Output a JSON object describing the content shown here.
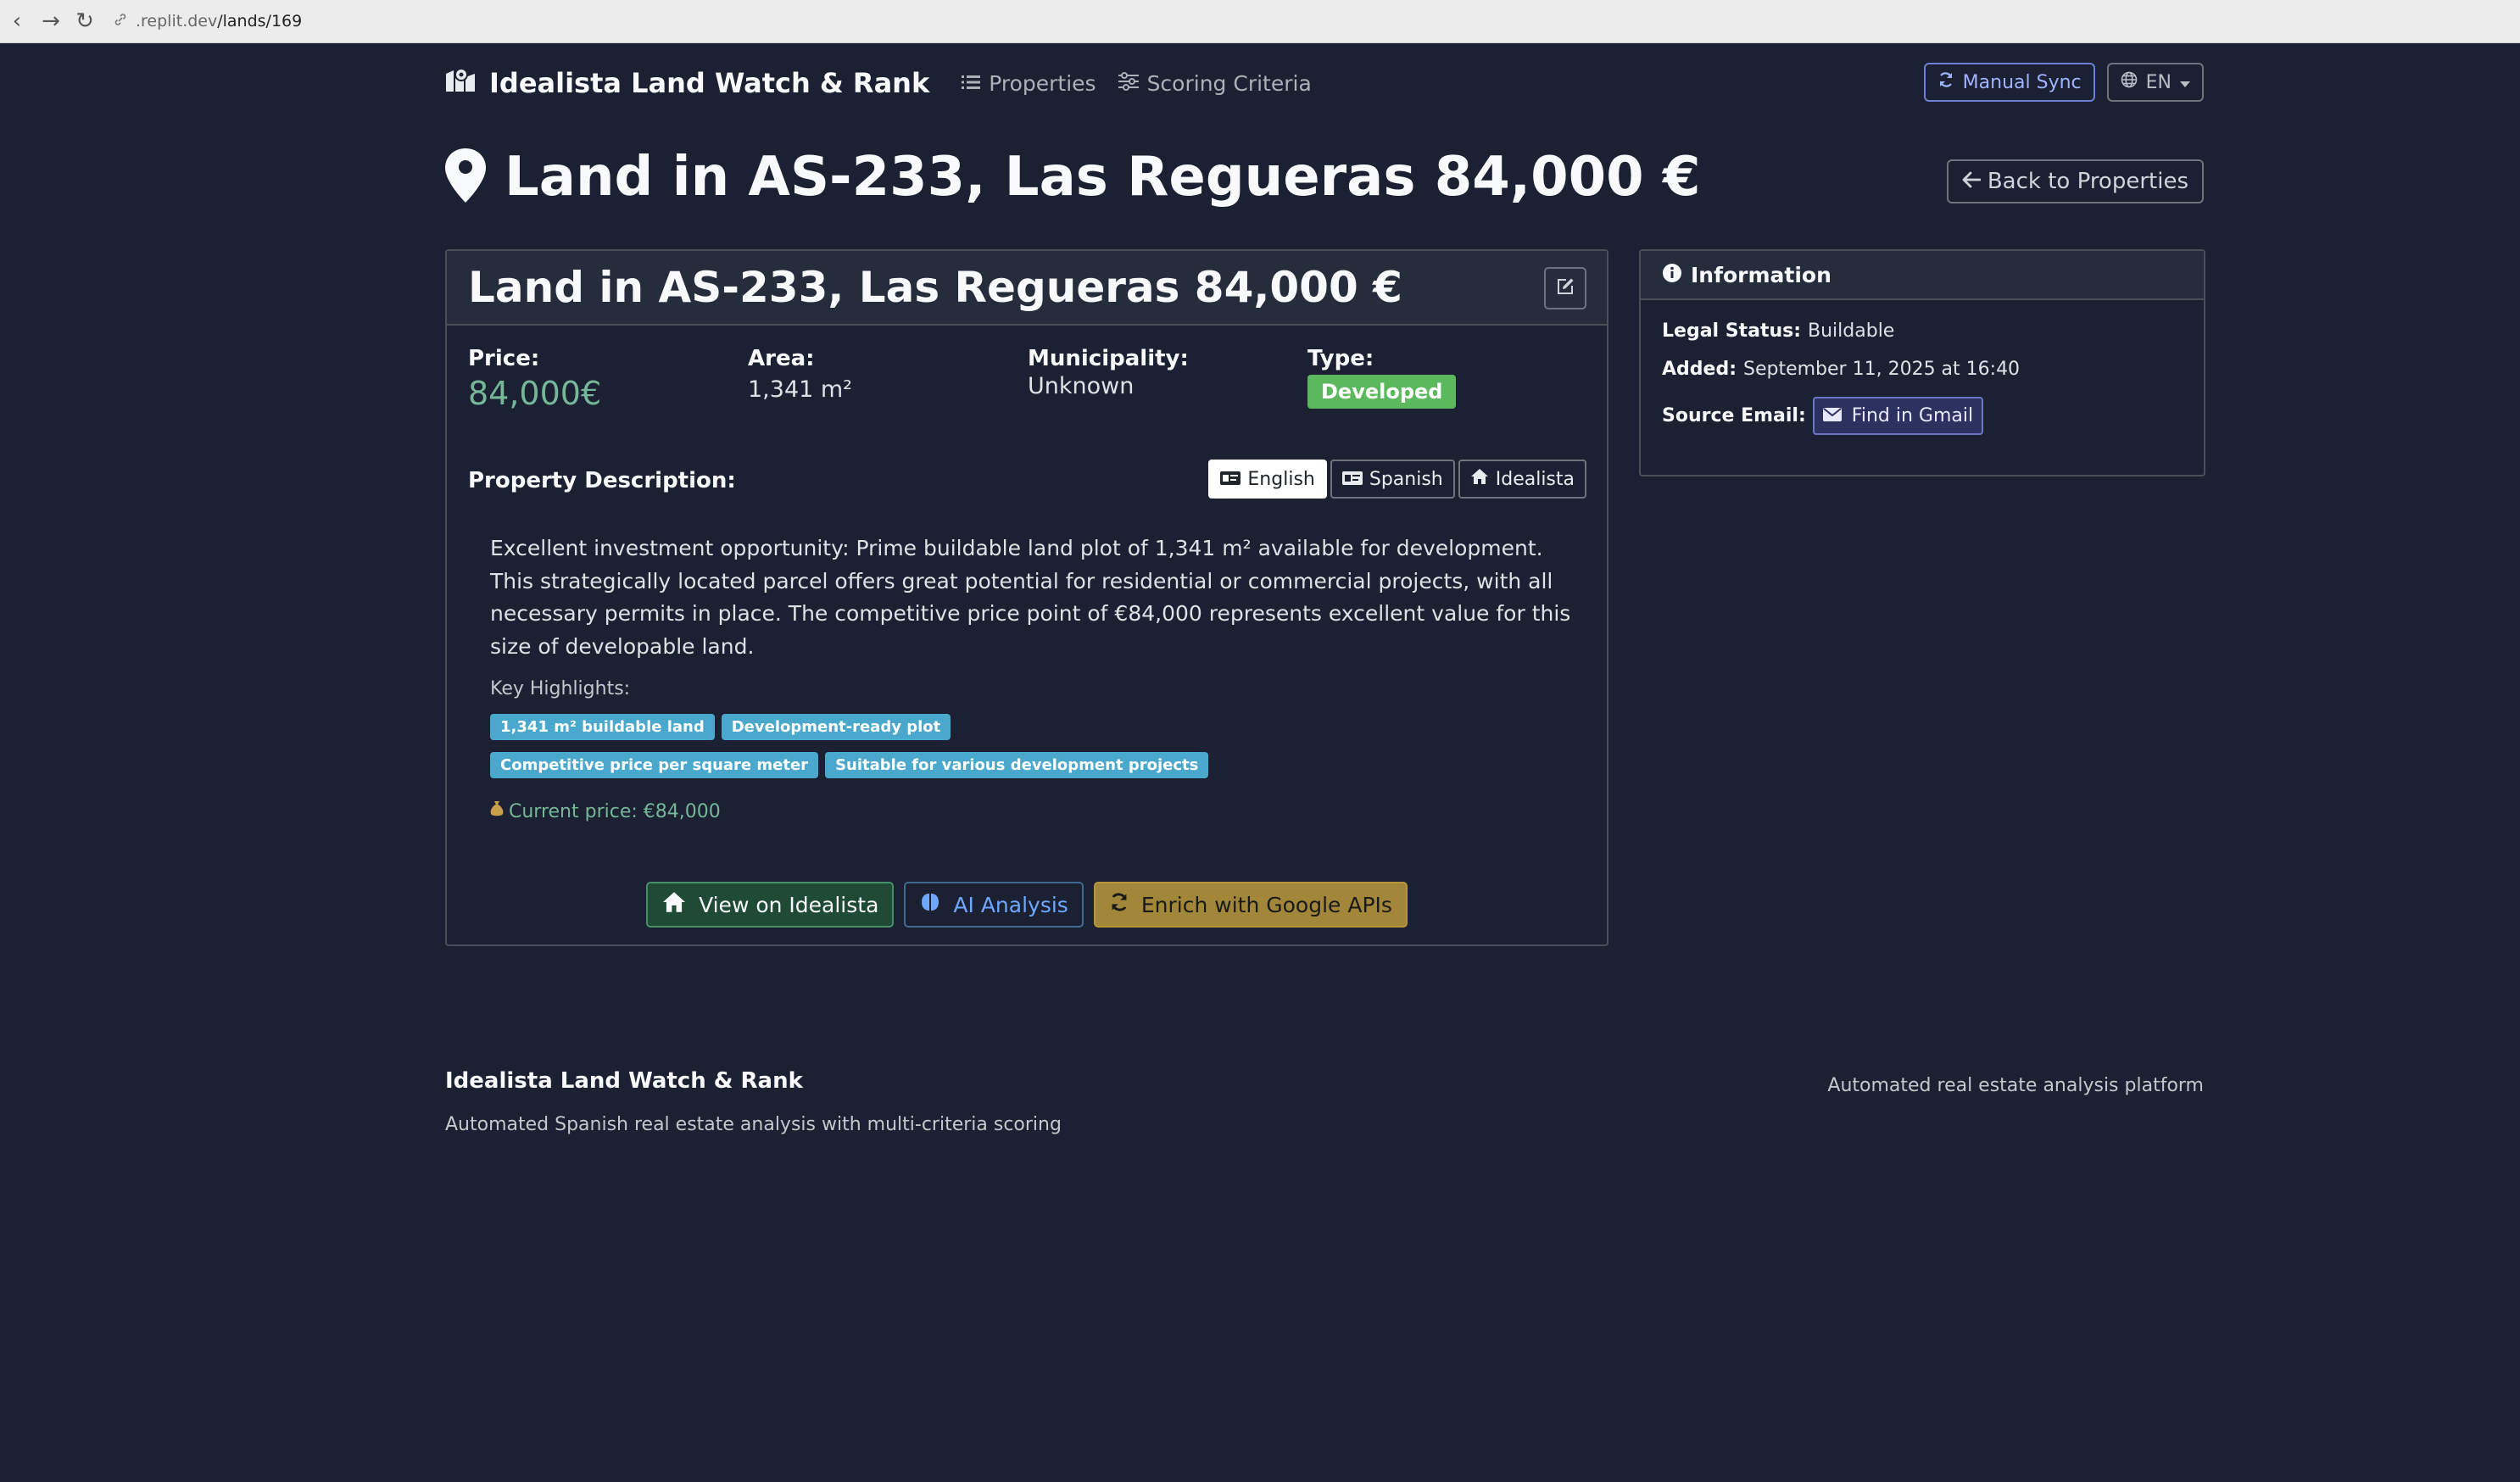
{
  "browser": {
    "url_domain": ".replit.dev",
    "url_path": "/lands/169"
  },
  "navbar": {
    "brand": "Idealista Land Watch & Rank",
    "links": [
      {
        "label": "Properties",
        "icon": "list-icon"
      },
      {
        "label": "Scoring Criteria",
        "icon": "sliders-icon"
      }
    ],
    "manual_sync": "Manual Sync",
    "language": "EN"
  },
  "page": {
    "title": "Land in AS-233, Las Regueras 84,000 €",
    "back_label": "Back to Properties"
  },
  "property": {
    "card_title": "Land in AS-233, Las Regueras 84,000 €",
    "price_label": "Price:",
    "price": "84,000€",
    "area_label": "Area:",
    "area": "1,341 m²",
    "municipality_label": "Municipality:",
    "municipality": "Unknown",
    "type_label": "Type:",
    "type": "Developed",
    "description_label": "Property Description:",
    "lang_tabs": [
      "English",
      "Spanish",
      "Idealista"
    ],
    "active_tab": "English",
    "description": "Excellent investment opportunity: Prime buildable land plot of 1,341 m² available for development. This strategically located parcel offers great potential for residential or commercial projects, with all necessary permits in place. The competitive price point of €84,000 represents excellent value for this size of developable land.",
    "highlights_label": "Key Highlights:",
    "highlights": [
      "1,341 m² buildable land",
      "Development-ready plot",
      "Competitive price per square meter",
      "Suitable for various development projects"
    ],
    "current_price": "Current price: €84,000",
    "actions": {
      "view": "View on Idealista",
      "ai": "AI Analysis",
      "enrich": "Enrich with Google APIs"
    }
  },
  "info": {
    "title": "Information",
    "legal_label": "Legal Status:",
    "legal": "Buildable",
    "added_label": "Added:",
    "added": "September 11, 2025 at 16:40",
    "source_label": "Source Email:",
    "gmail_btn": "Find in Gmail"
  },
  "footer": {
    "title": "Idealista Land Watch & Rank",
    "subtitle": "Automated Spanish real estate analysis with multi-criteria scoring",
    "right": "Automated real estate analysis platform"
  },
  "colors": {
    "background": "#1b2132",
    "price_green": "#75b798",
    "badge_green": "#5cb85c",
    "tag_blue": "#4aa8cc",
    "warning": "#a2873a"
  }
}
